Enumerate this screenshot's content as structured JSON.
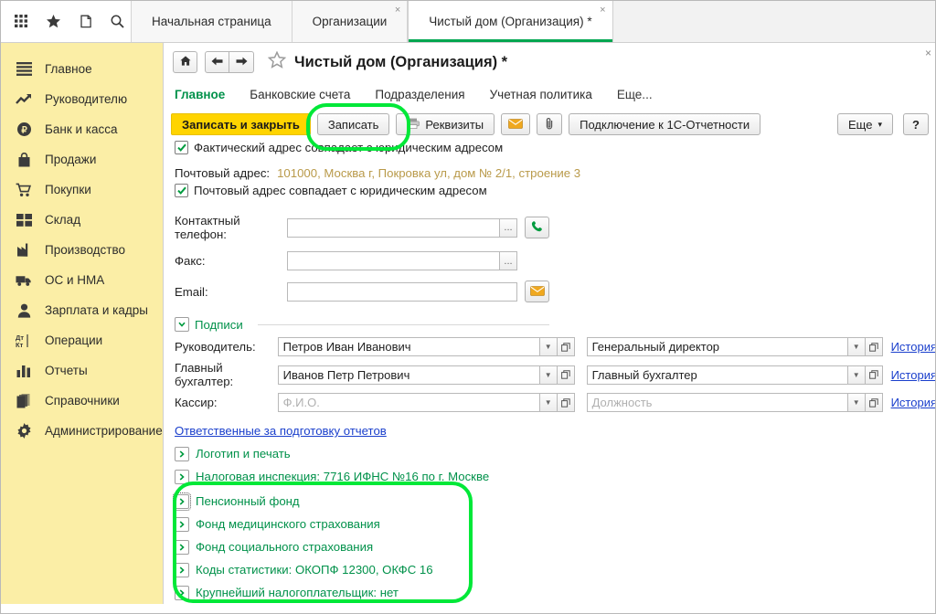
{
  "window": {
    "close_label": "×"
  },
  "tabs": [
    {
      "label": "Начальная страница",
      "active": false,
      "closable": false
    },
    {
      "label": "Организации",
      "active": false,
      "closable": true,
      "close_label": "×"
    },
    {
      "label": "Чистый дом (Организация) *",
      "active": true,
      "closable": true,
      "close_label": "×"
    }
  ],
  "system_icons": [
    {
      "name": "apps-grid-icon"
    },
    {
      "name": "star-favorites-icon"
    },
    {
      "name": "history-icon"
    },
    {
      "name": "search-icon"
    }
  ],
  "sidebar": {
    "items": [
      {
        "label": "Главное",
        "icon": "menu-lines-icon"
      },
      {
        "label": "Руководителю",
        "icon": "trend-chart-icon"
      },
      {
        "label": "Банк и касса",
        "icon": "ruble-coin-icon"
      },
      {
        "label": "Продажи",
        "icon": "shopping-bag-icon"
      },
      {
        "label": "Покупки",
        "icon": "shopping-cart-icon"
      },
      {
        "label": "Склад",
        "icon": "warehouse-grid-icon"
      },
      {
        "label": "Производство",
        "icon": "factory-icon"
      },
      {
        "label": "ОС и НМА",
        "icon": "truck-icon"
      },
      {
        "label": "Зарплата и кадры",
        "icon": "person-icon"
      },
      {
        "label": "Операции",
        "icon": "debit-credit-icon"
      },
      {
        "label": "Отчеты",
        "icon": "bar-chart-icon"
      },
      {
        "label": "Справочники",
        "icon": "books-icon"
      },
      {
        "label": "Администрирование",
        "icon": "gear-icon"
      }
    ]
  },
  "header": {
    "home_icon": "home-icon",
    "back_icon": "arrow-left-icon",
    "forward_icon": "arrow-right-icon",
    "favorite_icon": "star-outline-icon",
    "title": "Чистый дом (Организация) *"
  },
  "navlinks": [
    {
      "label": "Главное",
      "current": true
    },
    {
      "label": "Банковские счета",
      "current": false
    },
    {
      "label": "Подразделения",
      "current": false
    },
    {
      "label": "Учетная политика",
      "current": false
    },
    {
      "label": "Еще...",
      "current": false
    }
  ],
  "commandbar": {
    "save_close_label": "Записать и закрыть",
    "save_label": "Записать",
    "requisites_label": "Реквизиты",
    "requisites_icon": "printer-icon",
    "mail_icon": "envelope-icon",
    "attach_icon": "paperclip-icon",
    "report_connect_label": "Подключение к 1С-Отчетности",
    "more_label": "Еще",
    "more_caret": "▾",
    "help_label": "?"
  },
  "form": {
    "actual_address_checkbox": {
      "label": "Фактический адрес совпадает с юридическим адресом",
      "checked": true
    },
    "postal_address": {
      "label": "Почтовый адрес:",
      "value": "101000, Москва г, Покровка ул, дом № 2/1, строение 3"
    },
    "postal_address_checkbox": {
      "label": "Почтовый адрес совпадает с юридическим адресом",
      "checked": true
    },
    "phone": {
      "label": "Контактный телефон:",
      "value": "",
      "ellipsis": "...",
      "action_icon": "phone-icon"
    },
    "fax": {
      "label": "Факс:",
      "value": "",
      "ellipsis": "..."
    },
    "email": {
      "label": "Email:",
      "value": "",
      "action_icon": "envelope-icon"
    },
    "signatures_section": {
      "label": "Подписи",
      "expander_glyph": "⌄"
    },
    "signatures": [
      {
        "role_label": "Руководитель:",
        "name_value": "Петров Иван Иванович",
        "name_placeholder": "",
        "position_value": "Генеральный директор",
        "position_placeholder": "",
        "history_label": "История"
      },
      {
        "role_label": "Главный бухгалтер:",
        "name_value": "Иванов Петр Петрович",
        "name_placeholder": "",
        "position_value": "Главный бухгалтер",
        "position_placeholder": "",
        "history_label": "История"
      },
      {
        "role_label": "Кассир:",
        "name_value": "",
        "name_placeholder": "Ф.И.О.",
        "position_value": "",
        "position_placeholder": "Должность",
        "history_label": "История"
      }
    ],
    "responsible_link": "Ответственные за подготовку отчетов",
    "collapsed_sections": [
      {
        "label": "Логотип и печать",
        "glyph": "›",
        "focused": false,
        "highlighted": false
      },
      {
        "label": "Налоговая инспекция: 7716 ИФНС №16 по г. Москве",
        "glyph": "›",
        "focused": false,
        "highlighted": false
      },
      {
        "label": "Пенсионный фонд",
        "glyph": "›",
        "focused": true,
        "highlighted": true
      },
      {
        "label": "Фонд медицинского страхования",
        "glyph": "›",
        "focused": false,
        "highlighted": true
      },
      {
        "label": "Фонд социального страхования",
        "glyph": "›",
        "focused": false,
        "highlighted": true
      },
      {
        "label": "Коды статистики: ОКОПФ 12300, ОКФС 16",
        "glyph": "›",
        "focused": false,
        "highlighted": true
      },
      {
        "label": "Крупнейший налогоплательщик: нет",
        "glyph": "›",
        "focused": false,
        "highlighted": true
      }
    ]
  },
  "annotations": {
    "highlight_color": "#00e838",
    "save_button_ring": true,
    "sections_ring": true
  },
  "colors": {
    "sidebar_bg": "#fbeea6",
    "accent_green": "#00914a",
    "primary_yellow": "#ffd400",
    "link_blue": "#1a3fcc",
    "address_value": "#b99a4a"
  }
}
